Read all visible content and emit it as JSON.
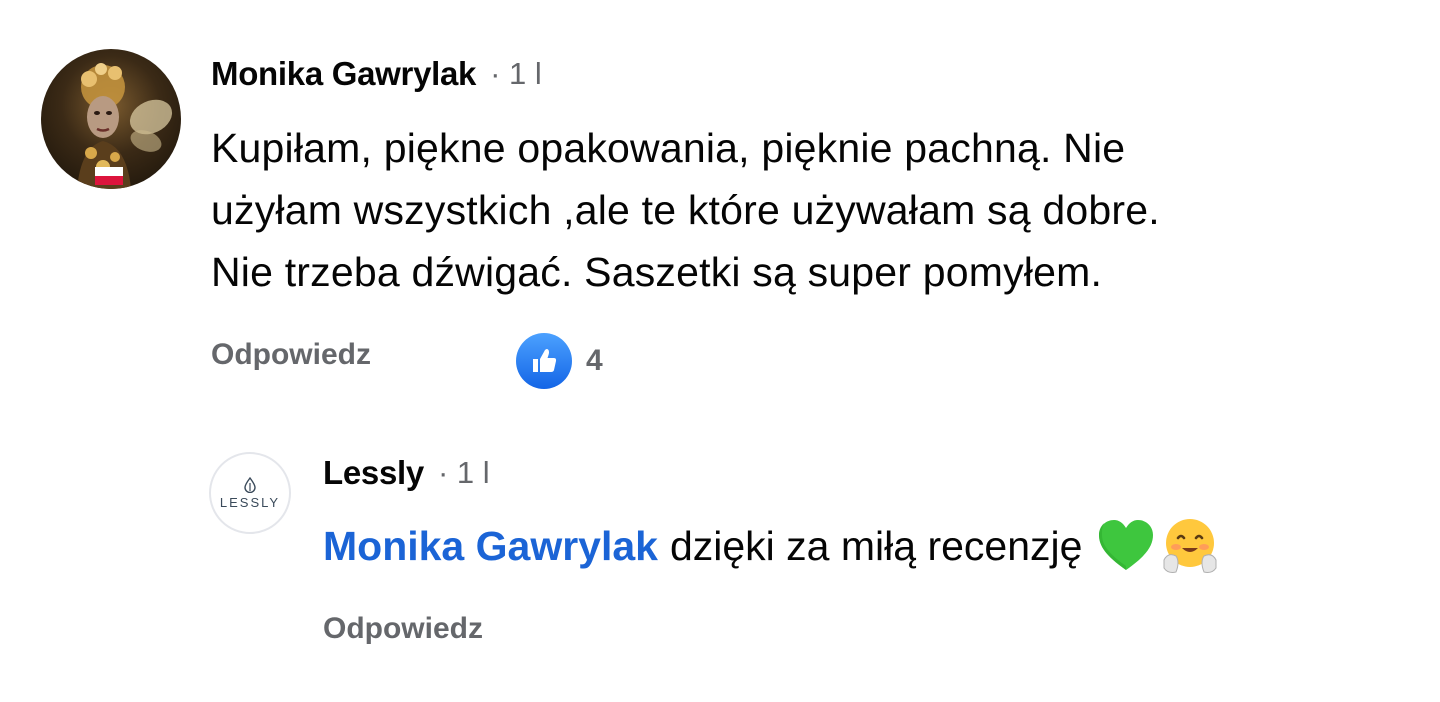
{
  "comment": {
    "author": "Monika Gawrylak",
    "meta": "· 1 l",
    "text_line1": "Kupiłam, piękne opakowania, pięknie pachną. Nie",
    "text_line2": "użyłam wszystkich ,ale te które używałam są dobre.",
    "text_line3": "Nie trzeba dźwigać. Saszetki są super pomyłem.",
    "reply_label": "Odpowiedz",
    "reaction_icon": "like-icon",
    "reaction_count": "4",
    "accent_color": "#1877f2"
  },
  "reply": {
    "author": "Lessly",
    "meta": "· 1 l",
    "avatar_logo_text": "LESSLY",
    "mention": "Monika Gawrylak",
    "text": "dzięki za miłą recenzję",
    "emojis": [
      "green-heart-icon",
      "hugging-face-icon"
    ],
    "reply_label": "Odpowiedz",
    "mention_color": "#1b64d6"
  }
}
